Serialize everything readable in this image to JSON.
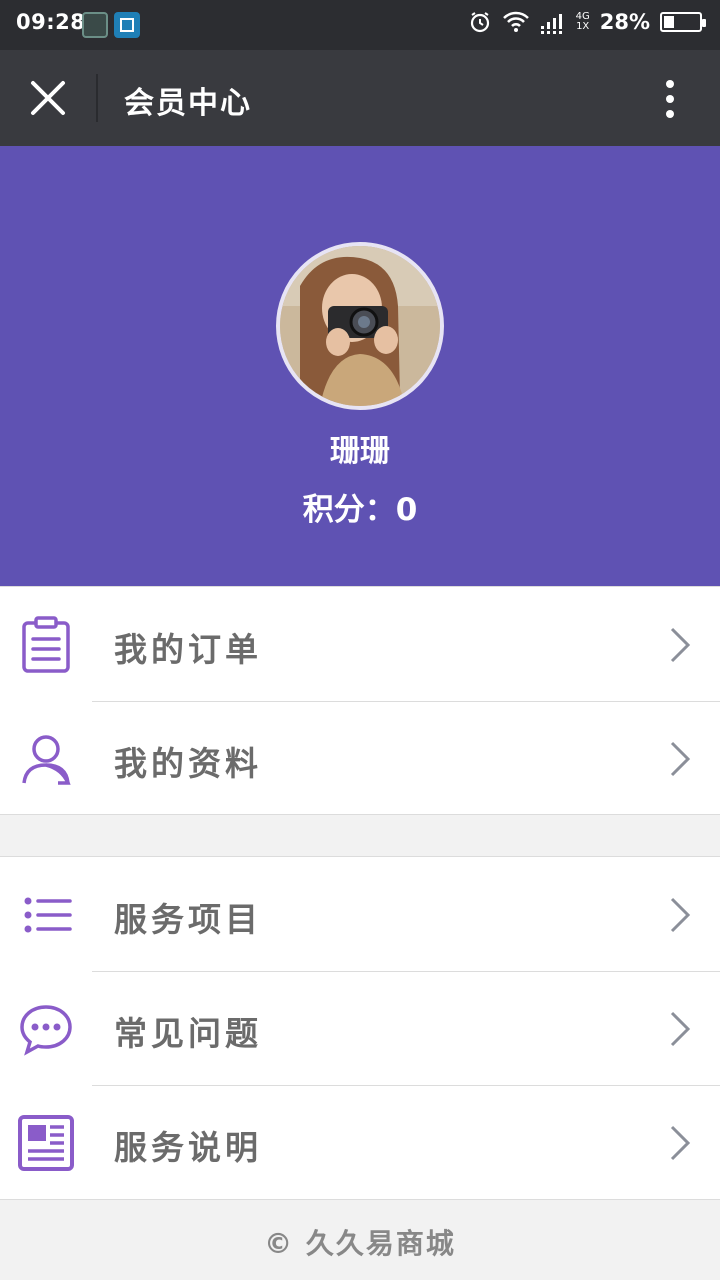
{
  "status_bar": {
    "time": "09:28",
    "net_type_top": "4G",
    "net_type_bottom": "1X",
    "battery_percent": "28%",
    "battery_level": 0.28,
    "icons": [
      "app-icon-1",
      "screenshot-icon",
      "alarm-icon",
      "wifi-icon",
      "signal-icon",
      "battery-icon"
    ]
  },
  "title_bar": {
    "title": "会员中心",
    "close_icon": "close-icon",
    "more_icon": "more-vertical-icon"
  },
  "profile": {
    "username": "珊珊",
    "points_text": "积分：0"
  },
  "menu": {
    "group1": [
      {
        "label": "我的订单",
        "icon": "clipboard-icon"
      },
      {
        "label": "我的资料",
        "icon": "user-icon"
      }
    ],
    "group2": [
      {
        "label": "服务项目",
        "icon": "list-icon"
      },
      {
        "label": "常见问题",
        "icon": "chat-bubble-icon"
      },
      {
        "label": "服务说明",
        "icon": "newspaper-icon"
      }
    ]
  },
  "footer": {
    "copyright": "© 久久易商城"
  },
  "colors": {
    "accent": "#5f52b3",
    "icon_purple": "#8a5cc9",
    "title_bar_bg": "#393a3f",
    "status_bar_bg": "#2c2d31",
    "chevron": "#8b8f99"
  }
}
